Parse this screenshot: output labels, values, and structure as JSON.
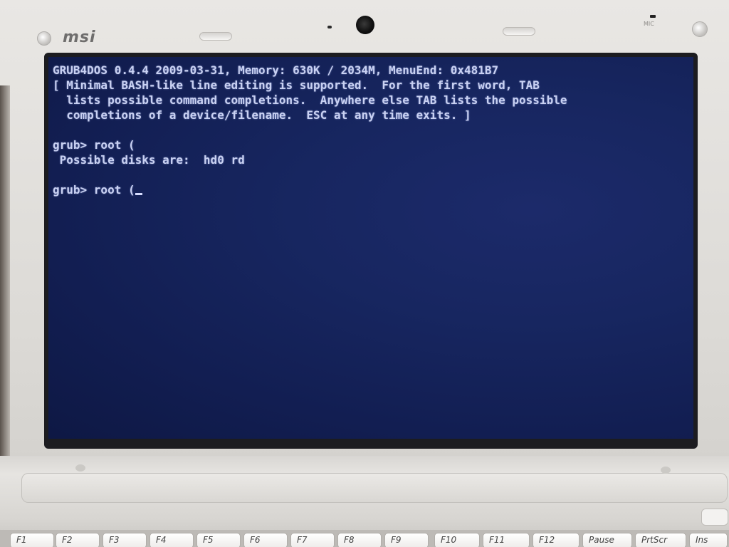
{
  "bezel": {
    "brand": "msi",
    "mic_label": "MIC"
  },
  "terminal": {
    "lines": [
      "GRUB4DOS 0.4.4 2009-03-31, Memory: 630K / 2034M, MenuEnd: 0x481B7",
      "[ Minimal BASH-like line editing is supported.  For the first word, TAB",
      "  lists possible command completions.  Anywhere else TAB lists the possible",
      "  completions of a device/filename.  ESC at any time exits. ]",
      "",
      "grub> root (",
      " Possible disks are:  hd0 rd",
      "",
      "grub> root ("
    ]
  },
  "keyboard": {
    "keys": [
      "F1",
      "F2",
      "F3",
      "F4",
      "F5",
      "F6",
      "F7",
      "F8",
      "F9",
      "F10",
      "F11",
      "F12",
      "Pause",
      "PrtScr",
      "Ins"
    ]
  }
}
